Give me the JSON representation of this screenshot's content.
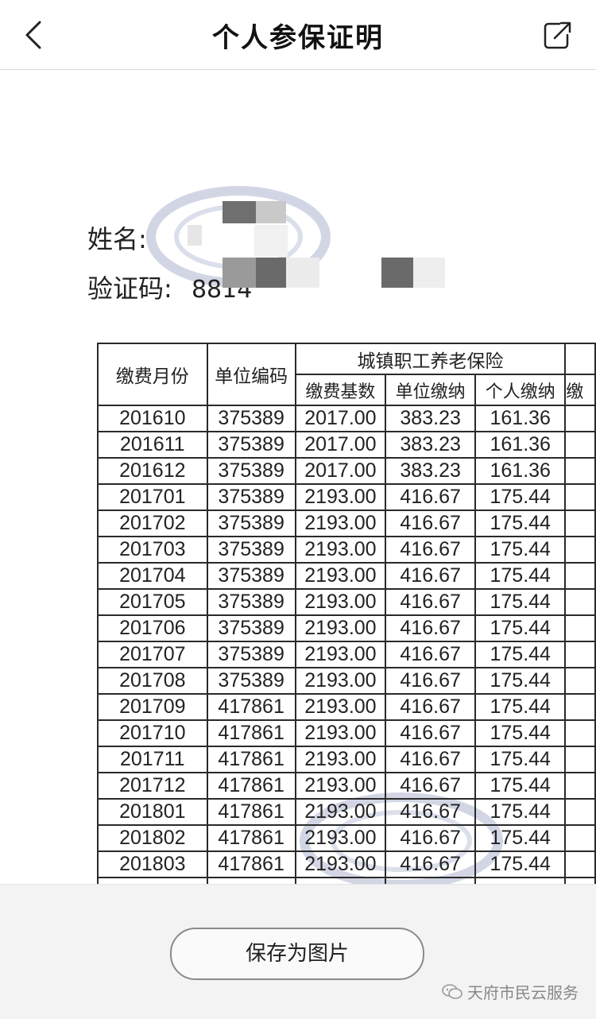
{
  "header": {
    "title": "个人参保证明",
    "back_icon": "chevron-left-icon",
    "share_icon": "share-icon"
  },
  "person": {
    "name_label": "姓名:",
    "name_value": "",
    "code_label": "验证码:",
    "code_value": "8814"
  },
  "table": {
    "col_month": "缴费月份",
    "col_unit_code": "单位编码",
    "group_pension": "城镇职工养老保险",
    "sub_base": "缴费基数",
    "sub_unit_pay": "单位缴纳",
    "sub_personal_pay": "个人缴纳",
    "next_col_partial": "缴",
    "rows": [
      {
        "month": "201610",
        "unit": "375389",
        "base": "2017.00",
        "unit_pay": "383.23",
        "personal_pay": "161.36"
      },
      {
        "month": "201611",
        "unit": "375389",
        "base": "2017.00",
        "unit_pay": "383.23",
        "personal_pay": "161.36"
      },
      {
        "month": "201612",
        "unit": "375389",
        "base": "2017.00",
        "unit_pay": "383.23",
        "personal_pay": "161.36"
      },
      {
        "month": "201701",
        "unit": "375389",
        "base": "2193.00",
        "unit_pay": "416.67",
        "personal_pay": "175.44"
      },
      {
        "month": "201702",
        "unit": "375389",
        "base": "2193.00",
        "unit_pay": "416.67",
        "personal_pay": "175.44"
      },
      {
        "month": "201703",
        "unit": "375389",
        "base": "2193.00",
        "unit_pay": "416.67",
        "personal_pay": "175.44"
      },
      {
        "month": "201704",
        "unit": "375389",
        "base": "2193.00",
        "unit_pay": "416.67",
        "personal_pay": "175.44"
      },
      {
        "month": "201705",
        "unit": "375389",
        "base": "2193.00",
        "unit_pay": "416.67",
        "personal_pay": "175.44"
      },
      {
        "month": "201706",
        "unit": "375389",
        "base": "2193.00",
        "unit_pay": "416.67",
        "personal_pay": "175.44"
      },
      {
        "month": "201707",
        "unit": "375389",
        "base": "2193.00",
        "unit_pay": "416.67",
        "personal_pay": "175.44"
      },
      {
        "month": "201708",
        "unit": "375389",
        "base": "2193.00",
        "unit_pay": "416.67",
        "personal_pay": "175.44"
      },
      {
        "month": "201709",
        "unit": "417861",
        "base": "2193.00",
        "unit_pay": "416.67",
        "personal_pay": "175.44"
      },
      {
        "month": "201710",
        "unit": "417861",
        "base": "2193.00",
        "unit_pay": "416.67",
        "personal_pay": "175.44"
      },
      {
        "month": "201711",
        "unit": "417861",
        "base": "2193.00",
        "unit_pay": "416.67",
        "personal_pay": "175.44"
      },
      {
        "month": "201712",
        "unit": "417861",
        "base": "2193.00",
        "unit_pay": "416.67",
        "personal_pay": "175.44"
      },
      {
        "month": "201801",
        "unit": "417861",
        "base": "2193.00",
        "unit_pay": "416.67",
        "personal_pay": "175.44"
      },
      {
        "month": "201802",
        "unit": "417861",
        "base": "2193.00",
        "unit_pay": "416.67",
        "personal_pay": "175.44"
      },
      {
        "month": "201803",
        "unit": "417861",
        "base": "2193.00",
        "unit_pay": "416.67",
        "personal_pay": "175.44"
      }
    ]
  },
  "footer": {
    "save_label": "保存为图片",
    "watermark_text": "天府市民云服务",
    "watermark_icon": "wechat-icon"
  },
  "colors": {
    "header_bg": "#ffffff",
    "bottom_bg": "#f3f3f3",
    "table_border": "#2a2a2a",
    "seal": "#8a96b8"
  }
}
